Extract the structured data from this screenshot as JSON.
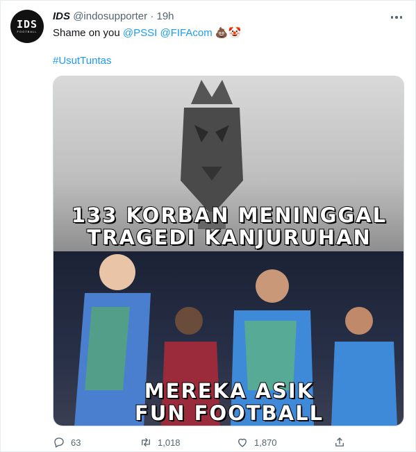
{
  "tweet": {
    "author_name": "IDS",
    "handle": "@indosupporter",
    "separator": "·",
    "time": "19h",
    "text_prefix": "Shame on you",
    "mentions": [
      "@PSSI",
      "@FIFAcom"
    ],
    "emojis": "💩🤡",
    "hashtag": "#UsutTuntas"
  },
  "avatar": {
    "logo_main": "IDS",
    "logo_sub": "FOOTBALL"
  },
  "media": {
    "caption_top_line1": "133 KORBAN MENINGGAL",
    "caption_top_line2": "TRAGEDI KANJURUHAN",
    "caption_bottom_line1": "MEREKA ASIK",
    "caption_bottom_line2": "FUN FOOTBALL"
  },
  "actions": {
    "replies": "63",
    "retweets": "1,018",
    "likes": "1,870"
  },
  "colors": {
    "accent": "#1d9bf0",
    "text": "#0f1419",
    "muted": "#536471"
  }
}
